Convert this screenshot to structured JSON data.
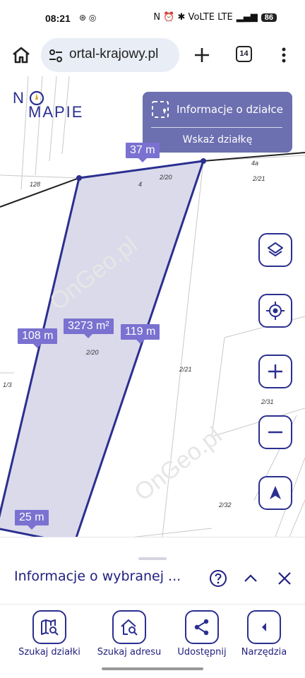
{
  "status_bar": {
    "time": "08:21",
    "notification_icons": "⊛ ◎",
    "right_icons": "N ⏰ ✱ VoLTE LTE",
    "battery": "86"
  },
  "browser": {
    "url": "ortal-krajowy.pl",
    "tab_count": "14"
  },
  "map": {
    "logo_text": "NO MAPIE",
    "info_panel": {
      "title": "Informacje o działce",
      "action": "Wskaż działkę"
    },
    "measurements": {
      "top": "37 m",
      "left": "108 m",
      "right": "119 m",
      "bottom": "25 m",
      "area": "3273 m²"
    },
    "plot_labels": [
      "128",
      "4",
      "2/20",
      "4a",
      "2/21",
      "128",
      "2/20",
      "2/21",
      "1/3",
      "2/31",
      "2/32"
    ],
    "watermark": "OnGeo.pl"
  },
  "sheet": {
    "title": "Informacje o wybranej ..."
  },
  "nav": {
    "items": [
      {
        "label": "Szukaj działki"
      },
      {
        "label": "Szukaj adresu"
      },
      {
        "label": "Udostępnij"
      },
      {
        "label": "Narzędzia"
      }
    ]
  },
  "colors": {
    "accent": "#2b2f8f",
    "label_bg": "#7a71d0",
    "panel_bg": "#6c6fb0",
    "parcel_fill": "#d3d4e8"
  }
}
